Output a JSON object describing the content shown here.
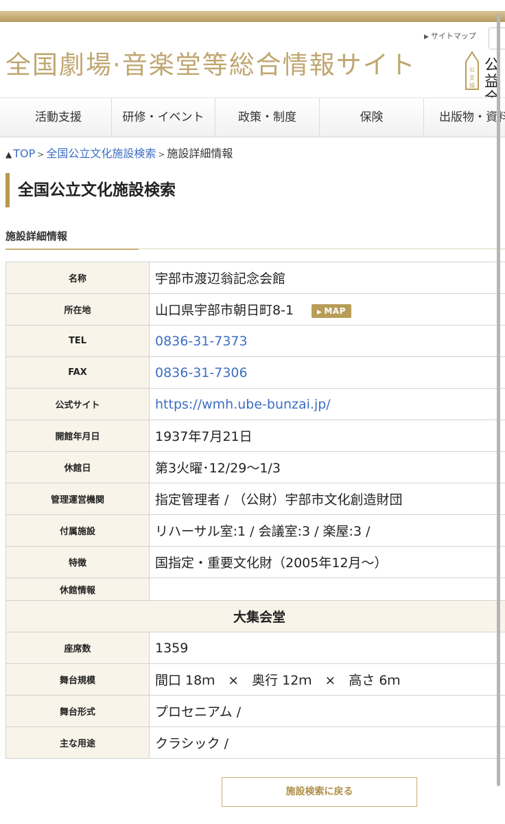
{
  "header": {
    "sitemap_label": "サイトマップ",
    "site_title": "全国劇場·音楽堂等総合情報サイト",
    "logo_text": "公益全国"
  },
  "nav": {
    "items": [
      {
        "label": "活動支援"
      },
      {
        "label": "研修・イベント"
      },
      {
        "label": "政策・制度"
      },
      {
        "label": "保険"
      },
      {
        "label": "出版物・資料"
      }
    ]
  },
  "breadcrumb": {
    "top": "TOP",
    "search": "全国公立文化施設検索",
    "current": "施設詳細情報"
  },
  "page": {
    "heading": "全国公立文化施設検索",
    "section_title": "施設詳細情報"
  },
  "facility": {
    "name_label": "名称",
    "name": "宇部市渡辺翁記念会館",
    "address_label": "所在地",
    "address": "山口県宇部市朝日町8-1",
    "map_button": "MAP",
    "tel_label": "TEL",
    "tel": "0836-31-7373",
    "fax_label": "FAX",
    "fax": "0836-31-7306",
    "site_label": "公式サイト",
    "site": "https://wmh.ube-bunzai.jp/",
    "opened_label": "開館年月日",
    "opened": "1937年7月21日",
    "closed_label": "休館日",
    "closed": "第3火曜･12/29〜1/3",
    "operator_label": "管理運営機関",
    "operator": "指定管理者 / （公財）宇部市文化創造財団",
    "attached_label": "付属施設",
    "attached": "リハーサル室:1 / 会議室:3 / 楽屋:3 /",
    "features_label": "特徴",
    "features": "国指定・重要文化財（2005年12月〜）",
    "closure_info_label": "休館情報",
    "closure_info": ""
  },
  "hall": {
    "name": "大集会堂",
    "seats_label": "座席数",
    "seats": "1359",
    "stage_size_label": "舞台規模",
    "stage_size": "間口 18ｍ　×　奥行 12ｍ　×　高さ 6ｍ",
    "stage_type_label": "舞台形式",
    "stage_type": "プロセニアム /",
    "usage_label": "主な用途",
    "usage": "クラシック /"
  },
  "footer": {
    "back_button": "施設検索に戻る"
  }
}
